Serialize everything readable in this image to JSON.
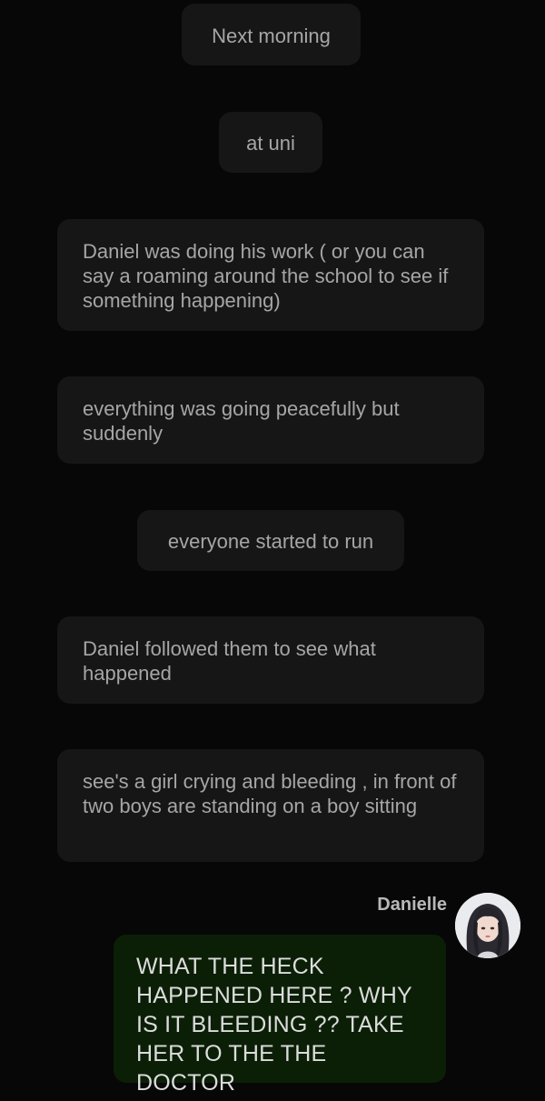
{
  "messages": [
    {
      "text": "Next morning"
    },
    {
      "text": "at uni"
    },
    {
      "text": "Daniel was doing his work ( or you can say a roaming around the school to see if something happening)"
    },
    {
      "text": "everything was going peacefully but suddenly"
    },
    {
      "text": "everyone started to run"
    },
    {
      "text": "Daniel followed them to see what happened"
    },
    {
      "text": "see's a girl crying and bleeding , in front of two boys are standing on a boy sitting"
    }
  ],
  "reply": {
    "sender": "Danielle",
    "text": "WHAT THE HECK HAPPENED HERE ? WHY IS IT BLEEDING ?? TAKE HER TO THE THE DOCTOR",
    "avatar_icon": "avatar-portrait-icon"
  },
  "colors": {
    "background": "#070707",
    "narration_bubble": "#161616",
    "narration_text": "#a6a6a6",
    "reply_bubble": "#0b1f07",
    "reply_text": "#dcdcdc"
  }
}
